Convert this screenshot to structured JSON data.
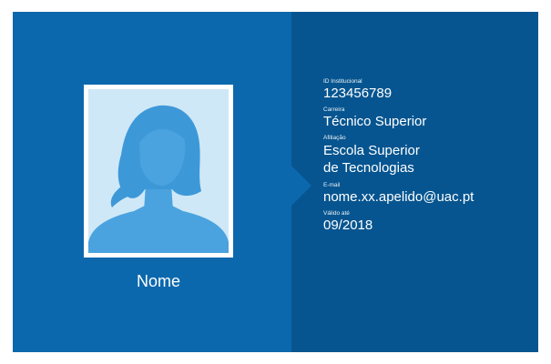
{
  "card": {
    "name": "Nome",
    "fields": {
      "institutional_id": {
        "label": "ID Institucional",
        "value": "123456789"
      },
      "career": {
        "label": "Carreira",
        "value": "Técnico Superior"
      },
      "affiliation": {
        "label": "Afiliação",
        "line1": "Escola Superior",
        "line2": "de Tecnologias"
      },
      "email": {
        "label": "E-mail",
        "value": "nome.xx.apelido@uac.pt"
      },
      "valid_until": {
        "label": "Válido até",
        "value": "09/2018"
      }
    }
  },
  "photo": {
    "icon": "female-avatar-silhouette-icon"
  },
  "colors": {
    "left_panel": "#0c68ad",
    "right_panel": "#065590",
    "photo_background": "#cfe8f7",
    "silhouette": "#4aa3df",
    "text": "#ffffff"
  }
}
